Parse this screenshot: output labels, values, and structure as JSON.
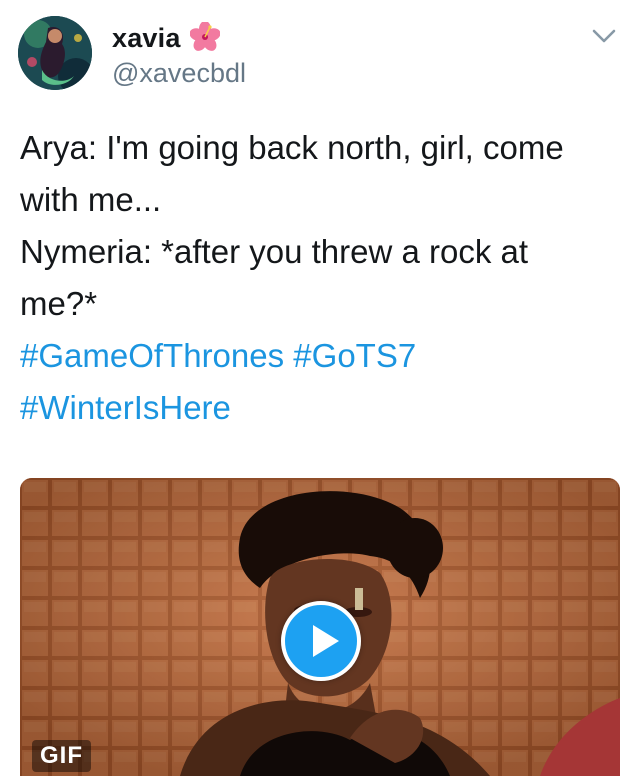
{
  "author": {
    "display_name": "xavia",
    "name_emoji": "hibiscus-icon",
    "handle": "@xavecbdl",
    "avatar": "avatar-image"
  },
  "menu_icon": "chevron-down-icon",
  "tweet": {
    "lines": [
      "Arya: I'm going back north, girl, come",
      "with me...",
      "Nymeria: *after you threw a rock at",
      "me?*"
    ],
    "hashtags_line1": [
      "#GameOfThrones",
      "#GoTS7"
    ],
    "hashtags_line2": [
      "#WinterIsHere"
    ]
  },
  "media": {
    "type": "gif",
    "badge": "GIF",
    "play_icon": "play-icon"
  },
  "colors": {
    "link": "#1b95e0",
    "text": "#14171a",
    "secondary": "#657786",
    "play_button": "#1da1f2"
  }
}
